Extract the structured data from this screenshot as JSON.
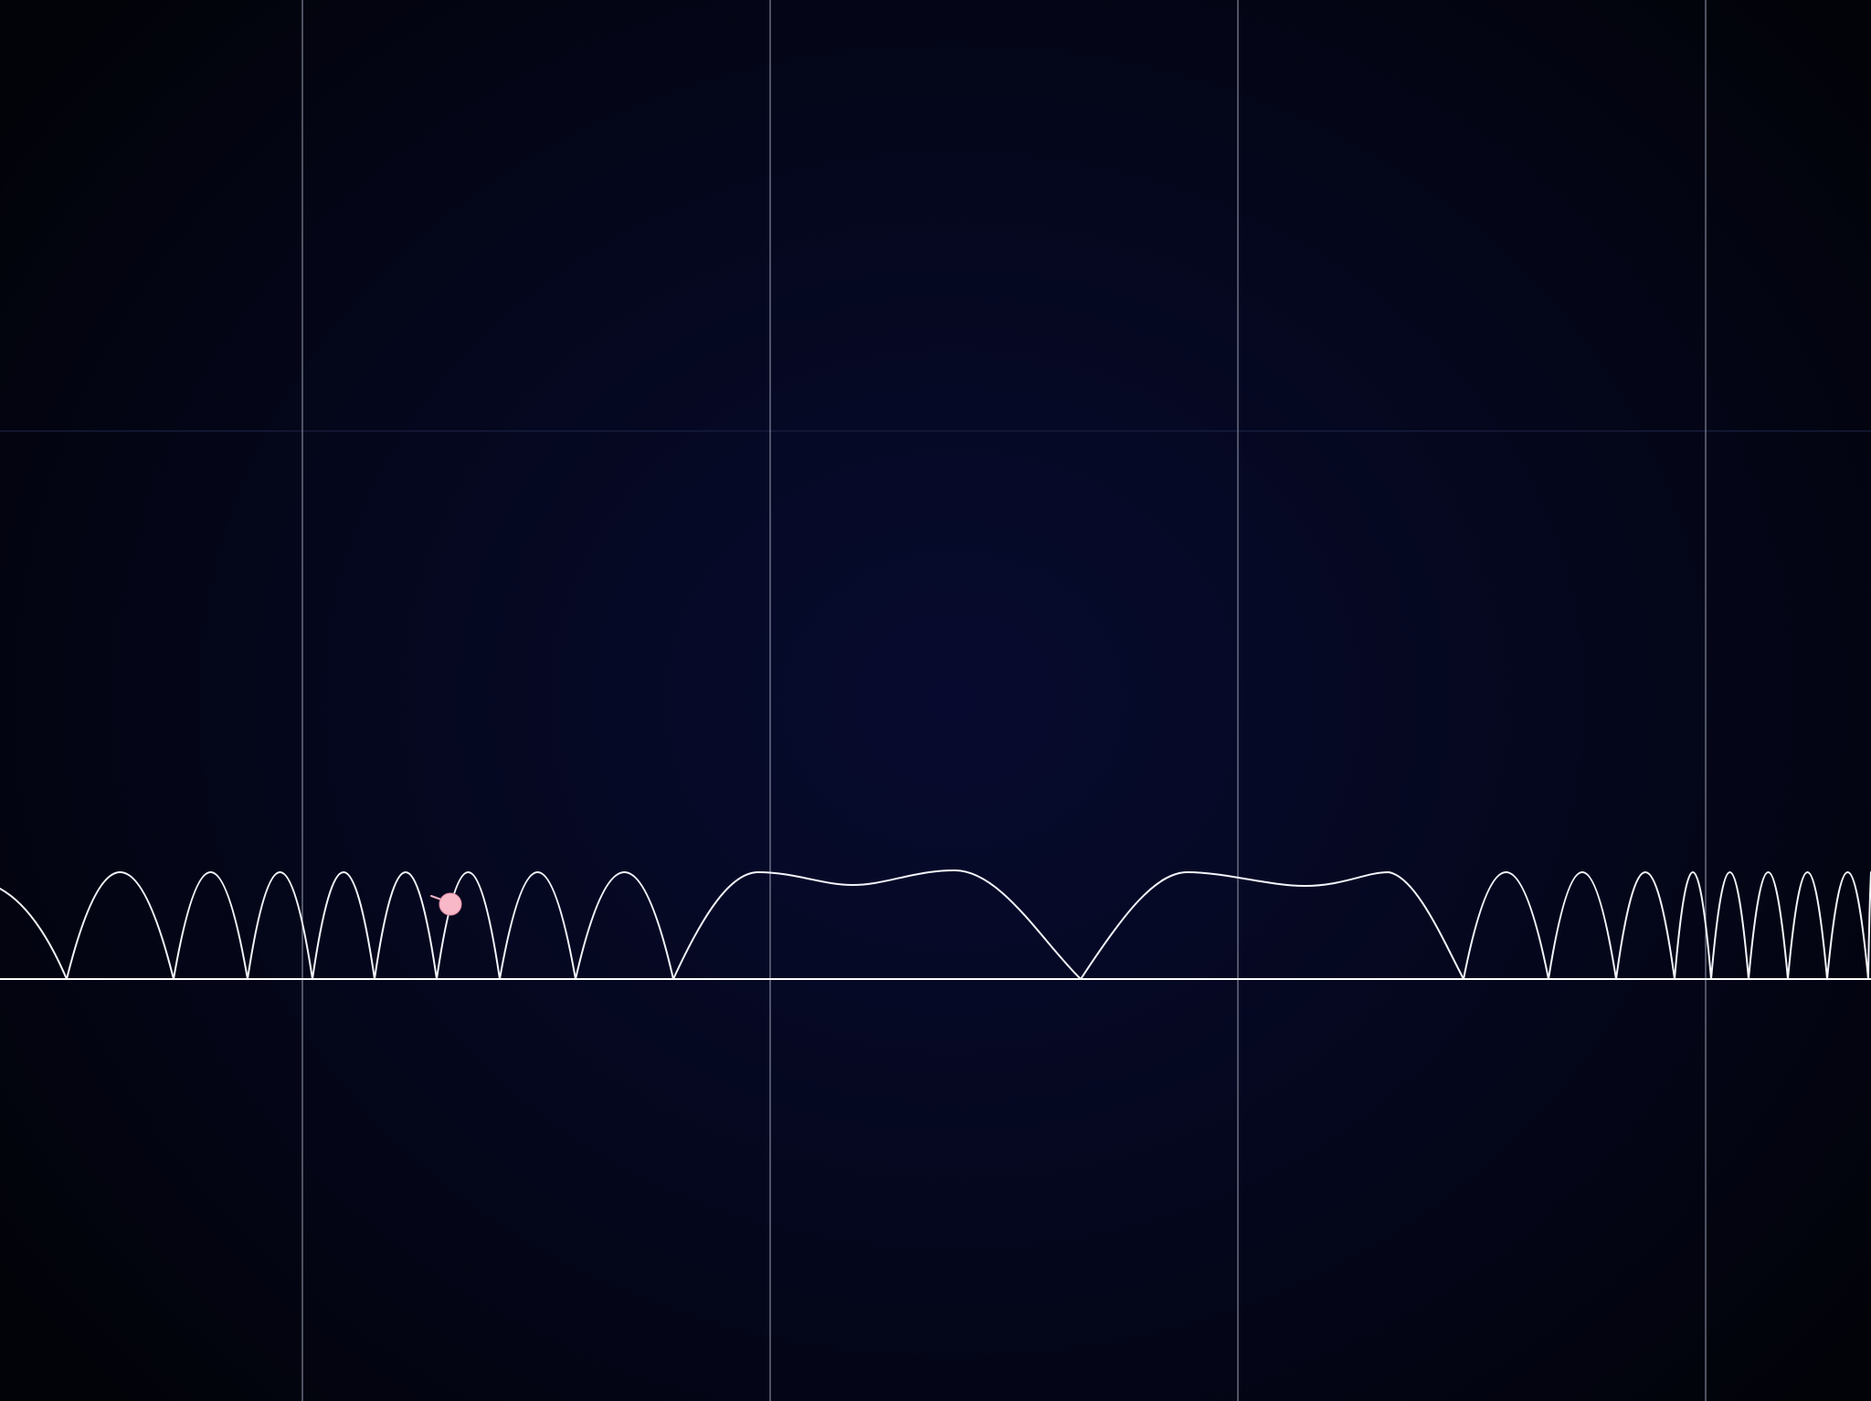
{
  "scene": {
    "background_center_color": "#070a2e",
    "background_edge_color": "#020309",
    "grid_color": "#8d93a6",
    "track_color": "#f2f4fa",
    "ball_color": "#f8b8c8"
  },
  "ball": {
    "icon": "ball-icon"
  }
}
